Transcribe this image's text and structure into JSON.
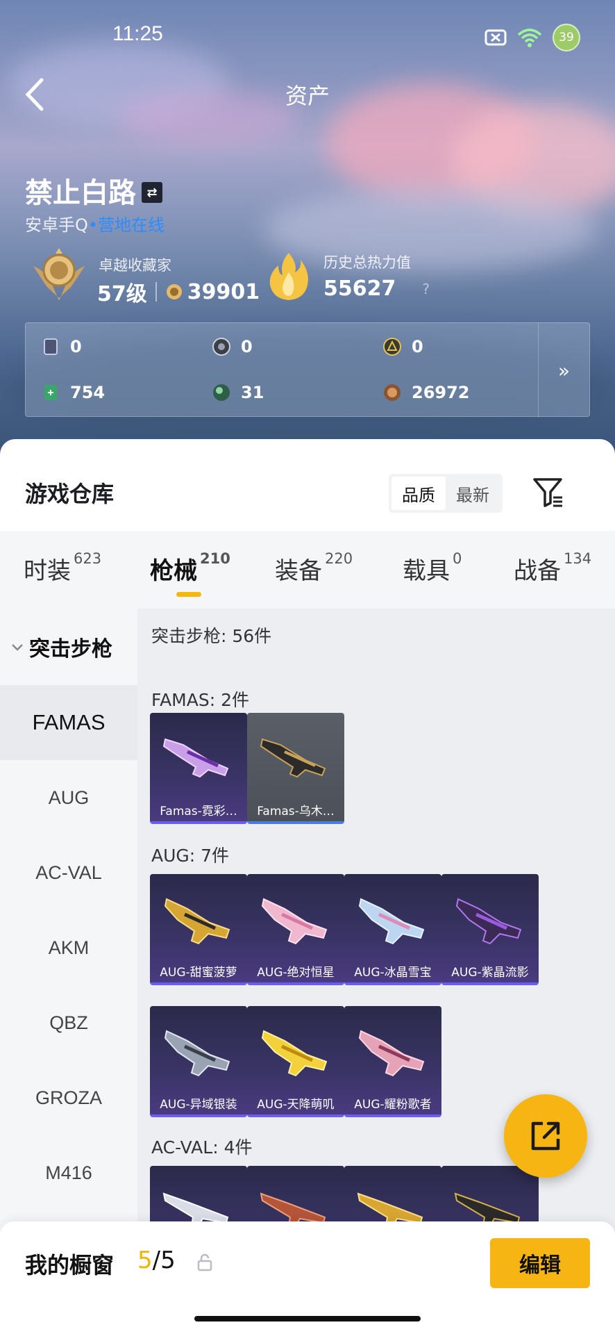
{
  "status": {
    "time": "11:25",
    "battery": "39"
  },
  "nav": {
    "title": "资产"
  },
  "profile": {
    "name": "禁止白路",
    "platform": "安卓手Q",
    "online": "营地在线",
    "rank_caption": "卓越收藏家",
    "level": "57级",
    "points": "39901",
    "heat_caption": "历史总热力值",
    "heat": "55627",
    "heat_help": "?"
  },
  "resources": [
    {
      "icon": "card-icon",
      "value": "0"
    },
    {
      "icon": "coin-grey-icon",
      "value": "0"
    },
    {
      "icon": "coin-gold-icon",
      "value": "0"
    },
    {
      "icon": "ticket-green-icon",
      "value": "754"
    },
    {
      "icon": "orb-green-icon",
      "value": "31"
    },
    {
      "icon": "coin-bronze-icon",
      "value": "26972"
    }
  ],
  "warehouse": {
    "title": "游戏仓库",
    "sort": [
      "品质",
      "最新"
    ],
    "tabs": [
      {
        "label": "时装",
        "count": "623"
      },
      {
        "label": "枪械",
        "count": "210"
      },
      {
        "label": "装备",
        "count": "220"
      },
      {
        "label": "载具",
        "count": "0"
      },
      {
        "label": "战备",
        "count": "134"
      }
    ],
    "category": "突击步枪",
    "sub_categories": [
      "FAMAS",
      "AUG",
      "AC-VAL",
      "AKM",
      "QBZ",
      "GROZA",
      "M416"
    ],
    "total": "突击步枪: 56件",
    "sections": [
      {
        "label": "FAMAS: 2件",
        "items": [
          "Famas-霓彩…",
          "Famas-乌木…"
        ]
      },
      {
        "label": "AUG: 7件",
        "items": [
          "AUG-甜蜜菠萝",
          "AUG-绝对恒星",
          "AUG-冰晶雪宝",
          "AUG-紫晶流影",
          "AUG-异域银装",
          "AUG-天降萌叽",
          "AUG-耀粉歌者"
        ]
      },
      {
        "label": "AC-VAL: 4件",
        "items": [
          "",
          "",
          "",
          ""
        ]
      }
    ]
  },
  "showcase": {
    "title": "我的橱窗",
    "current": "5",
    "max": "/5",
    "edit": "编辑"
  },
  "colors": {
    "accent": "#f6b512",
    "tab_indicator": "#f5b80a",
    "online": "#2d8cff"
  }
}
